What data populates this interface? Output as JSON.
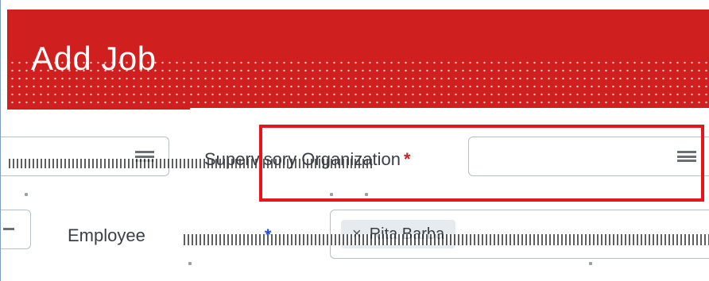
{
  "page": {
    "title": "Add Job"
  },
  "form": {
    "supervisory_organization": {
      "label": "Supervisory Organization",
      "required_marker": "*"
    },
    "employee": {
      "label": "Employee",
      "required_marker": "*",
      "selected_chip": "Rita Barba",
      "chip_remove_glyph": "×"
    }
  },
  "icons": {
    "header": "none",
    "prompt_icon": "menu-icon",
    "collapse_icon": "minus-icon"
  },
  "colors": {
    "header_red": "#cf1f1f",
    "highlight_red": "#e8141c",
    "required_red": "#cf1f1f",
    "required_blue": "#1d4fd6"
  }
}
